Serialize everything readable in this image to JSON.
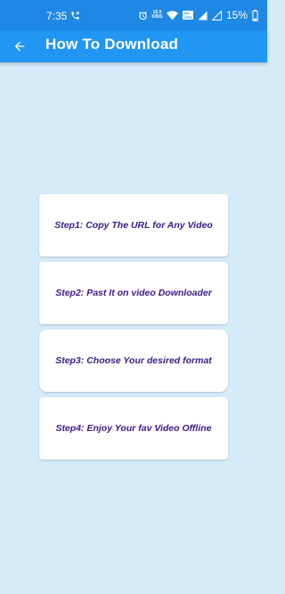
{
  "status_bar": {
    "time": "7:35",
    "speed_value": "15.0",
    "speed_unit": "KB/S",
    "wifi_badge_line1": "Vo)",
    "wifi_badge_line2": "LTE1",
    "battery_percent": "15%",
    "icons": [
      "call-icon",
      "alarm-icon",
      "wifi-icon",
      "signal-icon",
      "battery-icon"
    ]
  },
  "app_bar": {
    "title": "How To Download",
    "back_icon": "arrow-back-icon",
    "color": "#2196f3"
  },
  "steps": [
    {
      "label": "Step1: Copy The URL for Any Video"
    },
    {
      "label": "Step2: Past It on video Downloader"
    },
    {
      "label": "Step3: Choose Your desired format"
    },
    {
      "label": "Step4: Enjoy Your fav Video Offline"
    }
  ],
  "colors": {
    "status_bar": "#1e88e5",
    "background": "#d4ebfa",
    "step_text": "#3b1a86",
    "card": "#ffffff"
  }
}
